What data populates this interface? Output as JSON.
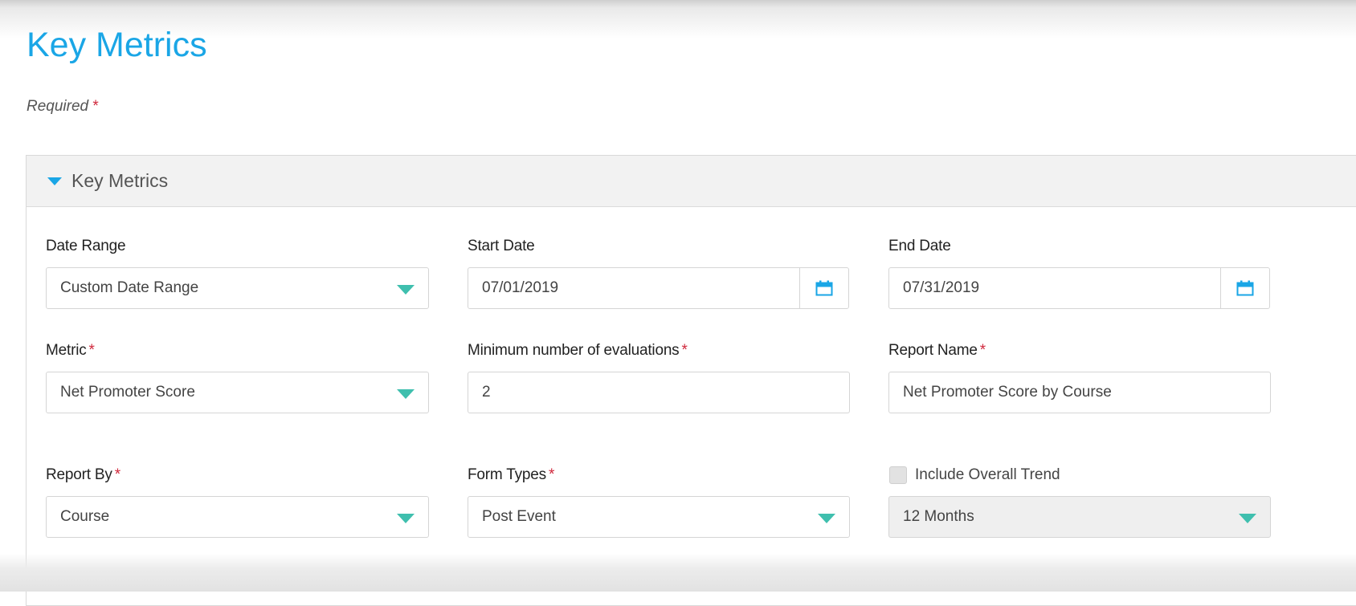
{
  "page": {
    "title": "Key Metrics",
    "required_label": "Required",
    "required_marker": "*"
  },
  "panel": {
    "title": "Key Metrics",
    "expanded": true
  },
  "form": {
    "date_range": {
      "label": "Date Range",
      "value": "Custom Date Range"
    },
    "start_date": {
      "label": "Start Date",
      "value": "07/01/2019"
    },
    "end_date": {
      "label": "End Date",
      "value": "07/31/2019"
    },
    "metric": {
      "label": "Metric",
      "required": "*",
      "value": "Net Promoter Score"
    },
    "min_evaluations": {
      "label": "Minimum number of evaluations",
      "required": "*",
      "value": "2"
    },
    "report_name": {
      "label": "Report Name",
      "required": "*",
      "value": "Net Promoter Score by Course"
    },
    "report_by": {
      "label": "Report By",
      "required": "*",
      "value": "Course"
    },
    "form_types": {
      "label": "Form Types",
      "required": "*",
      "value": "Post Event"
    },
    "include_overall_trend": {
      "label": "Include Overall Trend",
      "checked": false
    },
    "trend_period": {
      "value": "12 Months",
      "disabled": true
    }
  },
  "colors": {
    "accent_blue": "#1aa6e6",
    "dropdown_arrow": "#3fbfae",
    "required_star": "#d0283c"
  },
  "icons": {
    "collapse": "caret-down-icon",
    "dropdown": "chevron-down-icon",
    "calendar": "calendar-icon"
  }
}
